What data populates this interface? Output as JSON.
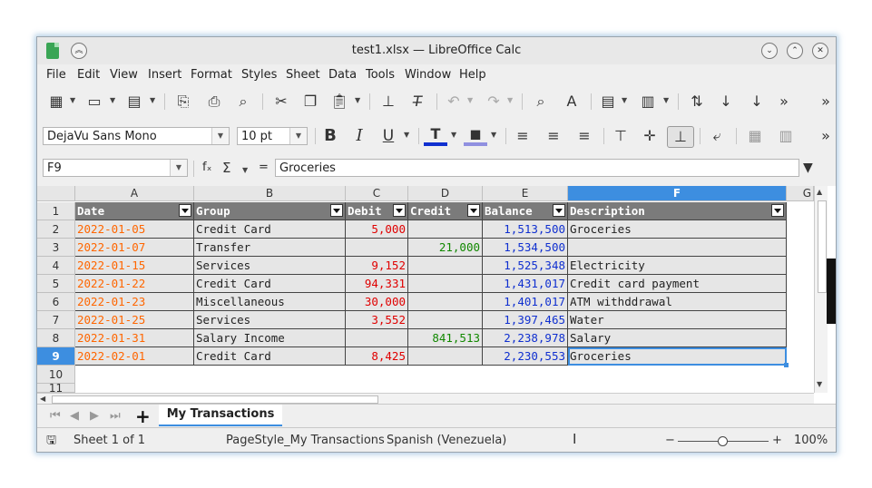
{
  "window": {
    "title": "test1.xlsx — LibreOffice Calc"
  },
  "menu": [
    "File",
    "Edit",
    "View",
    "Insert",
    "Format",
    "Styles",
    "Sheet",
    "Data",
    "Tools",
    "Window",
    "Help"
  ],
  "format_toolbar": {
    "font_name": "DejaVu Sans Mono",
    "font_size": "10 pt",
    "bold": "B",
    "italic": "I",
    "underline": "U"
  },
  "formula_bar": {
    "cell_ref": "F9",
    "fx": "fₓ",
    "sigma": "Σ",
    "equals": "=",
    "content": "Groceries"
  },
  "columns": [
    "A",
    "B",
    "C",
    "D",
    "E",
    "F",
    "G"
  ],
  "rows": [
    "1",
    "2",
    "3",
    "4",
    "5",
    "6",
    "7",
    "8",
    "9",
    "10",
    "11"
  ],
  "table": {
    "headers": [
      "Date",
      "Group",
      "Debit",
      "Credit",
      "Balance",
      "Description"
    ],
    "rows": [
      [
        "2022-01-05",
        "Credit Card",
        "5,000",
        "",
        "1,513,500",
        "Groceries"
      ],
      [
        "2022-01-07",
        "Transfer",
        "",
        "21,000",
        "1,534,500",
        ""
      ],
      [
        "2022-01-15",
        "Services",
        "9,152",
        "",
        "1,525,348",
        "Electricity"
      ],
      [
        "2022-01-22",
        "Credit Card",
        "94,331",
        "",
        "1,431,017",
        "Credit card payment"
      ],
      [
        "2022-01-23",
        "Miscellaneous",
        "30,000",
        "",
        "1,401,017",
        "ATM withddrawal"
      ],
      [
        "2022-01-25",
        "Services",
        "3,552",
        "",
        "1,397,465",
        "Water"
      ],
      [
        "2022-01-31",
        "Salary Income",
        "",
        "841,513",
        "2,238,978",
        "Salary"
      ],
      [
        "2022-02-01",
        "Credit Card",
        "8,425",
        "",
        "2,230,553",
        "Groceries"
      ]
    ]
  },
  "sheet_tabs": {
    "add": "+",
    "active": "My Transactions"
  },
  "status": {
    "sheet": "Sheet 1 of 1",
    "page_style": "PageStyle_My Transactions",
    "language": "Spanish (Venezuela)",
    "zoom_minus": "−",
    "zoom_plus": "+",
    "zoom": "100%"
  }
}
